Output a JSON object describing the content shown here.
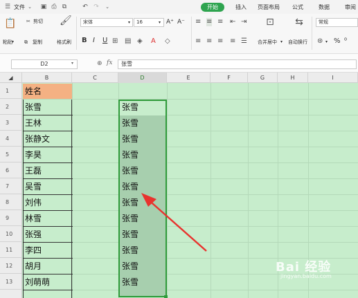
{
  "menu": {
    "file": "文件",
    "tabs": [
      "开始",
      "插入",
      "页面布局",
      "公式",
      "数据",
      "审阅"
    ]
  },
  "ribbon": {
    "cut": "剪切",
    "paste": "粘贴",
    "copy": "复制",
    "format_painter": "格式刷",
    "font_name": "宋体",
    "font_size": "16",
    "bold": "B",
    "italic": "I",
    "underline": "U",
    "font_grow": "A⁺",
    "font_shrink": "A⁻",
    "merge_center": "合并居中",
    "wrap_text": "自动换行",
    "number_format": "常规",
    "percent": "%"
  },
  "formula_bar": {
    "cell_ref": "D2",
    "fx": "fx",
    "content": "张雪"
  },
  "columns": [
    "B",
    "C",
    "D",
    "E",
    "F",
    "G",
    "H",
    "I"
  ],
  "selected_column": "D",
  "rows": [
    "1",
    "2",
    "3",
    "4",
    "5",
    "6",
    "7",
    "8",
    "9",
    "10",
    "11",
    "12",
    "13"
  ],
  "colB": [
    "姓名",
    "张雪",
    "王林",
    "张静文",
    "李昊",
    "王磊",
    "吴雪",
    "刘伟",
    "林雪",
    "张强",
    "李四",
    "胡月",
    "刘萌萌"
  ],
  "colD": [
    "",
    "张雪",
    "张雪",
    "张雪",
    "张雪",
    "张雪",
    "张雪",
    "张雪",
    "张雪",
    "张雪",
    "张雪",
    "张雪",
    "张雪"
  ],
  "watermark": {
    "main": "Bai 经验",
    "sub": "jingyan.baidu.com"
  },
  "colors": {
    "accent": "#2ea44f",
    "header_fill": "#f4b183",
    "grid_bg": "#c7edcc",
    "selection": "#a7cfae",
    "arrow": "#e8332e"
  }
}
